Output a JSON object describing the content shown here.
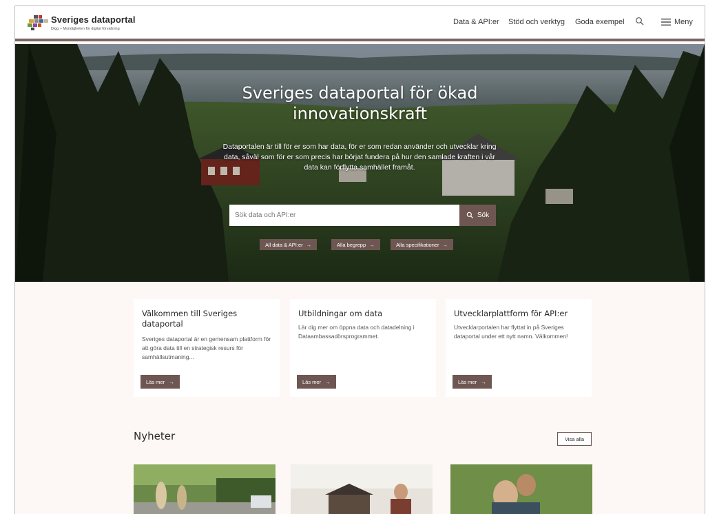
{
  "brand": {
    "title": "Sveriges dataportal",
    "subtitle": "Digg – Myndigheten för digital förvaltning",
    "logo_colors": [
      "#6d9b3a",
      "#c0392b",
      "#e0a030",
      "#2f6da3",
      "#8e44ad",
      "#555555"
    ]
  },
  "nav": {
    "items": [
      {
        "label": "Data & API:er"
      },
      {
        "label": "Stöd och verktyg"
      },
      {
        "label": "Goda exempel"
      }
    ],
    "search_icon": "search-icon",
    "menu_icon": "hamburger-icon",
    "menu_label": "Meny"
  },
  "hero": {
    "title_line1": "Sveriges dataportal för ökad",
    "title_line2": "innovationskraft",
    "lead": "Dataportalen är till för er som har data, för er som redan använder och utvecklar kring data, såväl som för er som precis har börjat fundera på hur den samlade kraften i vår data kan förflytta samhället framåt.",
    "search_placeholder": "Sök data och API:er",
    "search_button": "Sök",
    "chips": [
      {
        "label": "All data & API:er"
      },
      {
        "label": "Alla begrepp"
      },
      {
        "label": "Alla specifikationer"
      }
    ]
  },
  "cards": [
    {
      "title": "Välkommen till Sveriges dataportal",
      "text": "Sveriges dataportal är en gemensam plattform för att göra data till en strategisk resurs för samhällsutmaning...",
      "button": "Läs mer"
    },
    {
      "title": "Utbildningar om data",
      "text": "Lär dig mer om öppna data och datadelning i Dataambassadörsprogrammet.",
      "button": "Läs mer"
    },
    {
      "title": "Utvecklarplattform för API:er",
      "text": "Utvecklarportalen har flyttat in på Sveriges dataportal under ett nytt namn. Välkommen!",
      "button": "Läs mer"
    }
  ],
  "news": {
    "title": "Nyheter",
    "show_all": "Visa alla"
  },
  "colors": {
    "accent": "#6e5752",
    "page_bg": "#fdf8f6",
    "header_border": "#7a6560"
  }
}
